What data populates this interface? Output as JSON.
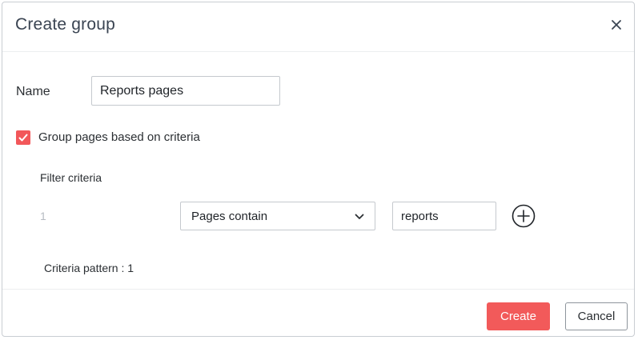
{
  "dialog": {
    "title": "Create group",
    "close_icon": "close-icon"
  },
  "name": {
    "label": "Name",
    "value": "Reports pages"
  },
  "group_by_criteria": {
    "checked": true,
    "label": "Group pages based on criteria",
    "check_icon": "checkmark-icon"
  },
  "filter": {
    "title": "Filter criteria",
    "rows": [
      {
        "index": "1",
        "condition": "Pages contain",
        "value": "reports"
      }
    ],
    "add_icon": "plus-circle-icon",
    "pattern_text": "Criteria pattern : 1"
  },
  "footer": {
    "create_label": "Create",
    "cancel_label": "Cancel"
  },
  "colors": {
    "accent": "#f25a5a",
    "checkbox": "#f2575a",
    "text": "#2b2f33",
    "muted": "#b7bcc2"
  }
}
